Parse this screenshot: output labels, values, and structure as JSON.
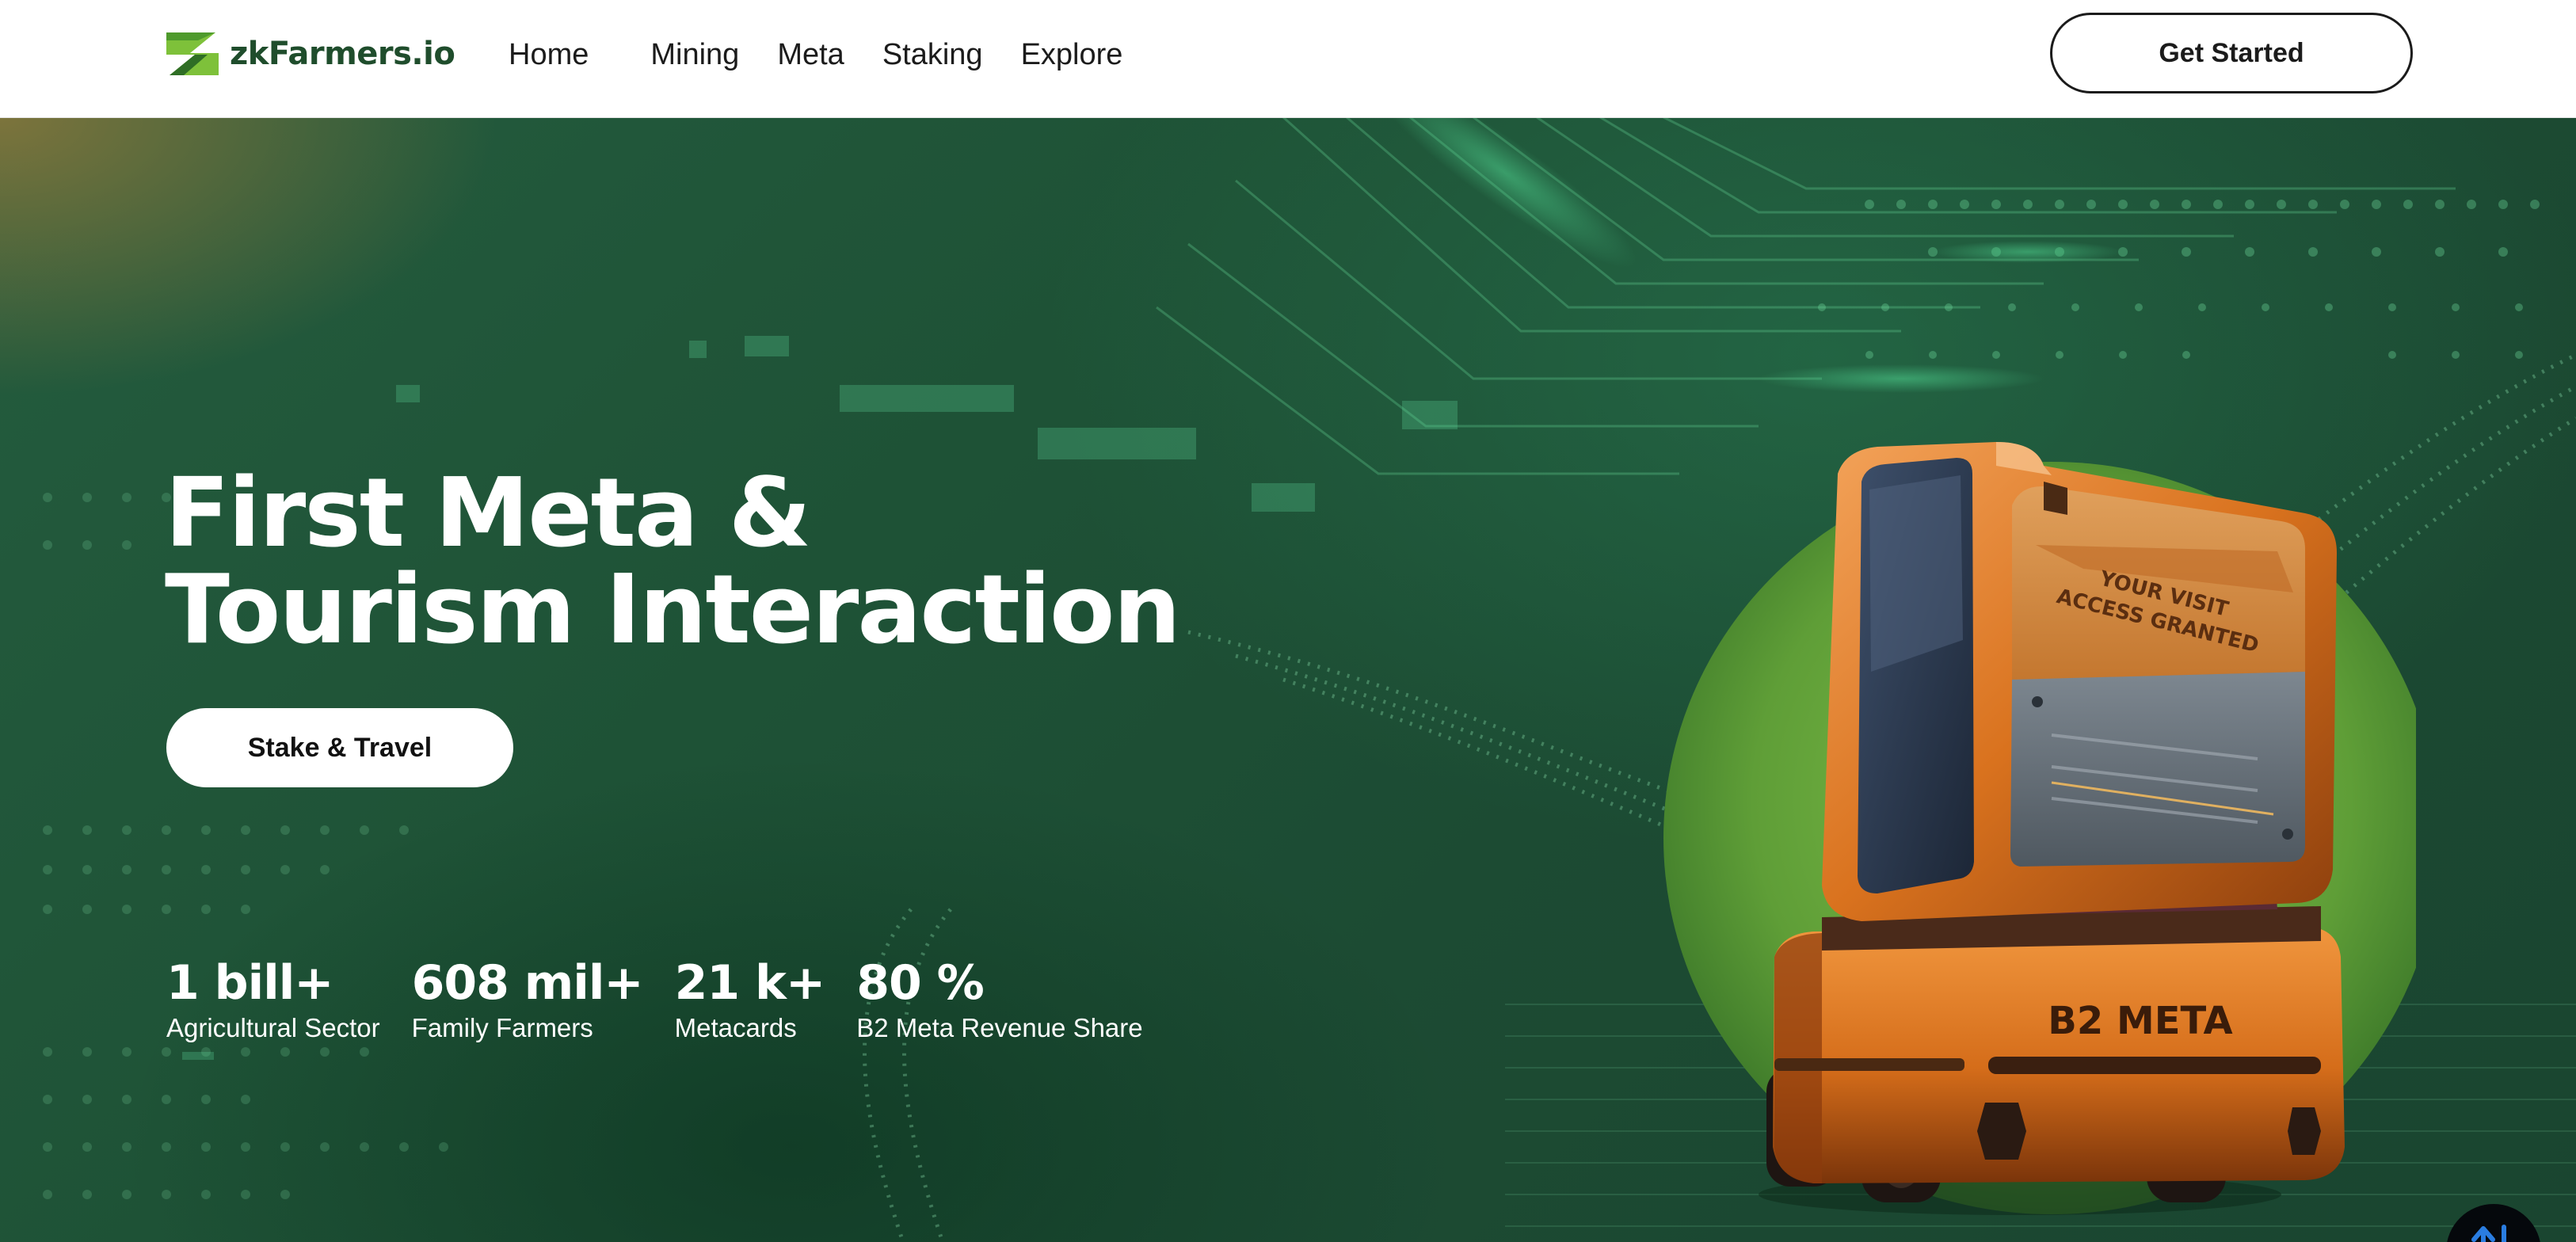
{
  "brand": {
    "name": "zkFarmers.io",
    "logo_icon": "z-leaf-logo-icon",
    "colors": {
      "logo_green": "#7ec13a",
      "logo_dark": "#1f4d2c"
    }
  },
  "nav": {
    "items": [
      {
        "label": "Home"
      },
      {
        "label": "Mining"
      },
      {
        "label": "Meta"
      },
      {
        "label": "Staking"
      },
      {
        "label": "Explore"
      }
    ],
    "cta_label": "Get Started"
  },
  "hero": {
    "headline_line1": "First Meta &",
    "headline_line2": "Tourism Interaction",
    "button_label": "Stake & Travel",
    "stats": [
      {
        "value": "1 bill+",
        "label": "Agricultural Sector"
      },
      {
        "value": "608 mil+",
        "label": "Family Farmers"
      },
      {
        "value": "21 k+",
        "label": "Metacards"
      },
      {
        "value": "80 %",
        "label": "B2 Meta Revenue Share"
      }
    ],
    "artwork": {
      "icon": "b2-meta-robot-illustration",
      "stamp_line1": "YOUR VISIT",
      "stamp_line2": "ACCESS GRANTED",
      "body_label": "B2 META"
    },
    "colors": {
      "background": "#1e5236",
      "accent_green": "#6aa83a",
      "robot_orange": "#d9721e"
    }
  },
  "scroll_button": {
    "icon": "up-down-arrows-icon",
    "color": "#2a7de1"
  }
}
